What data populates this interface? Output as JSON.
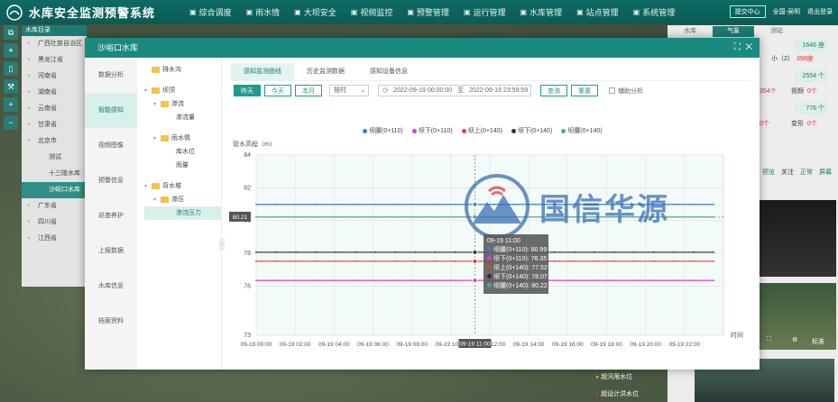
{
  "app": {
    "title": "水库安全监测预警系统",
    "nav": [
      {
        "label": "综合调度",
        "icon": "home-icon"
      },
      {
        "label": "雨水情",
        "icon": "rain-icon"
      },
      {
        "label": "大坝安全",
        "icon": "dam-icon"
      },
      {
        "label": "视频监控",
        "icon": "camera-icon"
      },
      {
        "label": "预警管理",
        "icon": "bell-icon"
      },
      {
        "label": "运行管理",
        "icon": "list-icon"
      },
      {
        "label": "水库管理",
        "icon": "reservoir-icon"
      },
      {
        "label": "站点管理",
        "icon": "station-icon"
      },
      {
        "label": "系统管理",
        "icon": "gear-icon"
      }
    ],
    "msg_center": "提交中心",
    "user": "全国-吴明",
    "logout": "退出登录"
  },
  "region": {
    "header": "水库目录",
    "items": [
      "广西壮族自治区",
      "黑龙江省",
      "河南省",
      "湖南省",
      "云南省",
      "甘肃省",
      "北京市",
      "测试",
      "十三陵水库",
      "沙峪口水库",
      "广东省",
      "四川省",
      "江西省"
    ]
  },
  "right": {
    "tabs": [
      "水库",
      "气象",
      "测站"
    ],
    "stats": [
      "1646 座",
      "2554 个",
      "776 个"
    ],
    "texts": [
      "小（2）",
      "398座",
      "354个",
      "视频",
      "0个",
      "0个",
      "变形",
      "0个"
    ],
    "links": [
      "预览",
      "关注",
      "正常",
      "屏幕"
    ],
    "cam_label": "标准",
    "legend": [
      "超汛限水位",
      "超设计洪水位"
    ]
  },
  "modal": {
    "title": "沙峪口水库",
    "menu": [
      "数据分析",
      "智能感知",
      "视频图像",
      "预警信息",
      "巡查养护",
      "上报数据",
      "水库信息",
      "档案资料"
    ],
    "active_menu": 1,
    "tree": [
      {
        "label": "排水沟",
        "level": 0,
        "caret": ""
      },
      {
        "label": "坝顶",
        "level": 0,
        "caret": "▾"
      },
      {
        "label": "渗流",
        "level": 1,
        "caret": "▾"
      },
      {
        "label": "渗流量",
        "level": 2,
        "caret": ""
      },
      {
        "label": "雨水情",
        "level": 1,
        "caret": "▾"
      },
      {
        "label": "库水位",
        "level": 2,
        "caret": ""
      },
      {
        "label": "雨量",
        "level": 2,
        "caret": ""
      },
      {
        "label": "背水坡",
        "level": 0,
        "caret": "▾"
      },
      {
        "label": "渗压",
        "level": 1,
        "caret": "▾"
      },
      {
        "label": "渗流压力",
        "level": 2,
        "caret": "",
        "selected": true
      }
    ],
    "tabs": [
      "感知监测曲线",
      "历史监测数据",
      "感知设备信息"
    ],
    "filters": {
      "yesterday": "昨天",
      "today": "今天",
      "month": "本月",
      "granularity": "按时",
      "start": "2022-09-19 00:00:00",
      "sep": "至",
      "end": "2022-09-19 23:59:59",
      "query": "查询",
      "reset": "重置",
      "assist": "辅助分析"
    }
  },
  "chart_data": {
    "type": "line",
    "ylabel": "管水高程（m）",
    "xlabel": "时间",
    "ylim": [
      73,
      84
    ],
    "yticks": [
      73,
      76,
      78,
      80,
      82,
      84
    ],
    "x": [
      "09-19 00:00",
      "09-19 02:00",
      "09-19 04:00",
      "09-19 06:00",
      "09-19 08:00",
      "09-19 10:00",
      "09-19 12:00",
      "09-19 14:00",
      "09-19 16:00",
      "09-19 18:00",
      "09-19 20:00",
      "09-19 22:00"
    ],
    "hover_x": "09-19 11:00",
    "hover_index": 11,
    "y_marker": "80.21",
    "series": [
      {
        "name": "坝腰(0+110)",
        "color": "#3b7dd8",
        "values": [
          80.99,
          80.99,
          80.99,
          80.99,
          80.99,
          80.99,
          80.99,
          80.99,
          80.99,
          80.99,
          80.99,
          80.99,
          80.99,
          80.99,
          80.99,
          80.99,
          80.99,
          80.99,
          80.99,
          80.99,
          80.99,
          80.99,
          80.99,
          80.99
        ]
      },
      {
        "name": "坝下(0+110)",
        "color": "#d93bd8",
        "values": [
          76.35,
          76.35,
          76.35,
          76.35,
          76.35,
          76.35,
          76.35,
          76.35,
          76.35,
          76.35,
          76.35,
          76.35,
          76.35,
          76.35,
          76.35,
          76.35,
          76.35,
          76.35,
          76.35,
          76.35,
          76.35,
          76.35,
          76.35,
          76.35
        ]
      },
      {
        "name": "坝上(0+140)",
        "color": "#e04040",
        "values": [
          77.52,
          77.52,
          77.52,
          77.52,
          77.52,
          77.52,
          77.52,
          77.52,
          77.52,
          77.52,
          77.52,
          77.52,
          77.52,
          77.52,
          77.52,
          77.52,
          77.52,
          77.52,
          77.52,
          77.52,
          77.52,
          77.52,
          77.52,
          77.52
        ]
      },
      {
        "name": "坝下(0+140)",
        "color": "#333333",
        "values": [
          78.07,
          78.07,
          78.07,
          78.07,
          78.07,
          78.07,
          78.07,
          78.07,
          78.07,
          78.07,
          78.07,
          78.07,
          78.07,
          78.07,
          78.07,
          78.07,
          78.07,
          78.07,
          78.07,
          78.07,
          78.07,
          78.07,
          78.07,
          78.07
        ]
      },
      {
        "name": "坝腰(0+140)",
        "color": "#4aa896",
        "values": [
          80.22,
          80.22,
          80.22,
          80.22,
          80.22,
          80.22,
          80.22,
          80.22,
          80.22,
          80.22,
          80.22,
          80.22,
          80.22,
          80.22,
          80.22,
          80.22,
          80.22,
          80.22,
          80.22,
          80.22,
          80.22,
          80.22,
          80.22,
          80.22
        ]
      }
    ],
    "tooltip": {
      "title": "09-19 11:00",
      "rows": [
        "坝腰(0+110): 80.99",
        "坝下(0+110): 76.35",
        "坝上(0+140): 77.52",
        "坝下(0+140): 78.07",
        "坝腰(0+140): 80.22"
      ]
    },
    "watermark": "国信华源"
  }
}
